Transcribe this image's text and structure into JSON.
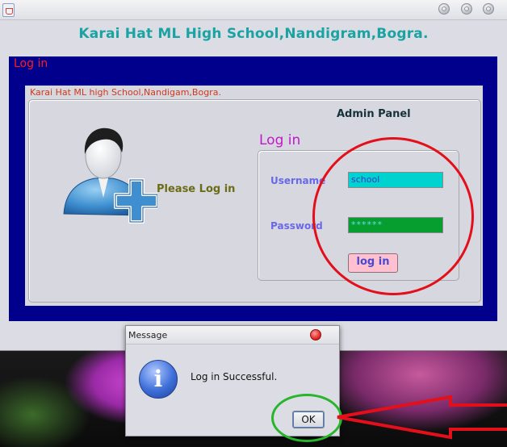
{
  "window": {
    "school_name": "Karai Hat ML High School,Nandigram,Bogra."
  },
  "login_frame": {
    "title": "Log in",
    "panel_title": "Karai Hat ML high School,Nandigam,Bogra.",
    "admin_panel": "Admin Panel",
    "please_login": "Please Log in",
    "heading": "Log in",
    "username_label": "Username",
    "username_value": "school",
    "password_label": "Password",
    "password_value": "******",
    "login_button": "log in"
  },
  "dialog": {
    "title": "Message",
    "icon": "info-icon",
    "message": "Log in Successful.",
    "ok_button": "OK"
  },
  "colors": {
    "frame_blue": "#00008c",
    "header_teal": "#1aa3a3",
    "username_bg": "#00d2d0",
    "password_bg": "#069e2e",
    "login_button_bg": "#ffc0cf",
    "annotation_red": "#e30f1a",
    "annotation_green": "#27b52a"
  }
}
